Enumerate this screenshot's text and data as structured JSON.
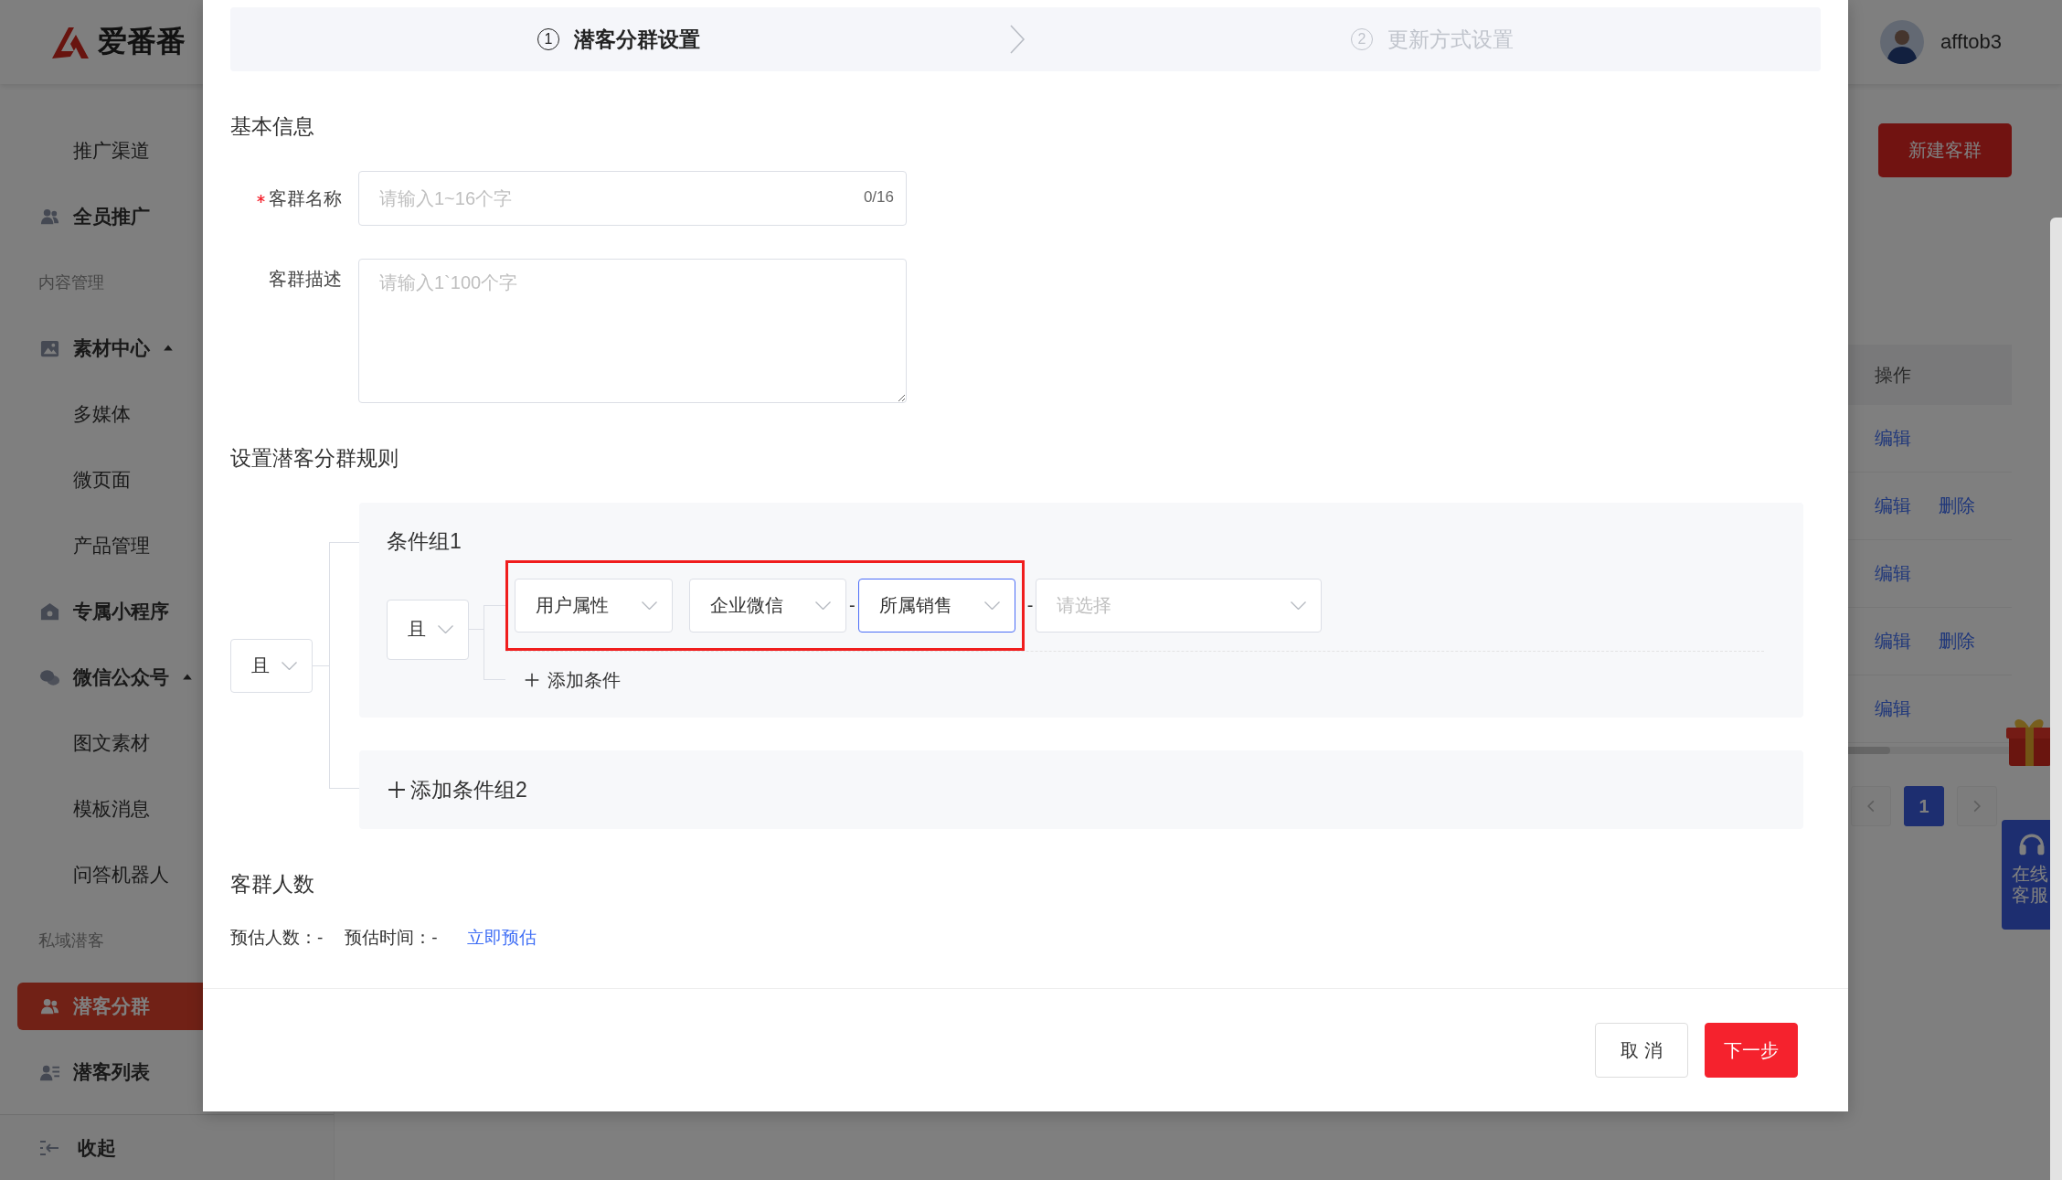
{
  "header": {
    "logo": "爱番番",
    "user": "afftob3"
  },
  "sidebar": {
    "items": [
      {
        "label": "推广渠道",
        "kind": "sub",
        "selected": false
      },
      {
        "label": "全员推广",
        "kind": "main",
        "selected": false
      },
      {
        "label": "内容管理",
        "kind": "section"
      },
      {
        "label": "素材中心",
        "kind": "main",
        "expanded": true,
        "selected": false
      },
      {
        "label": "多媒体",
        "kind": "sub",
        "selected": false
      },
      {
        "label": "微页面",
        "kind": "sub",
        "selected": false
      },
      {
        "label": "产品管理",
        "kind": "sub",
        "selected": false
      },
      {
        "label": "专属小程序",
        "kind": "main",
        "selected": false
      },
      {
        "label": "微信公众号",
        "kind": "main",
        "expanded": true,
        "selected": false
      },
      {
        "label": "图文素材",
        "kind": "sub",
        "selected": false
      },
      {
        "label": "模板消息",
        "kind": "sub",
        "selected": false
      },
      {
        "label": "问答机器人",
        "kind": "sub",
        "selected": false
      },
      {
        "label": "私域潜客",
        "kind": "section"
      },
      {
        "label": "潜客分群",
        "kind": "main",
        "selected": true
      },
      {
        "label": "潜客列表",
        "kind": "main",
        "selected": false
      }
    ],
    "collapse": "收起"
  },
  "main": {
    "new_button": "新建客群",
    "table": {
      "columns": [
        "操作"
      ],
      "rows": [
        {
          "actions": [
            "编辑"
          ]
        },
        {
          "actions": [
            "编辑",
            "删除"
          ]
        },
        {
          "actions": [
            "编辑"
          ]
        },
        {
          "actions": [
            "编辑",
            "删除"
          ]
        },
        {
          "actions": [
            "编辑"
          ]
        }
      ]
    },
    "pagination": {
      "pages": [
        {
          "label": "1",
          "selected": true
        }
      ]
    },
    "support": "在线客服"
  },
  "modal": {
    "steps": [
      {
        "number": "1",
        "label": "潜客分群设置",
        "selected": true
      },
      {
        "number": "2",
        "label": "更新方式设置",
        "selected": false
      }
    ],
    "basic_info": {
      "title": "基本信息",
      "fields": [
        {
          "kind": "input",
          "label": "客群名称",
          "required": true,
          "placeholder": "请输入1~16个字",
          "counter": "0/16"
        },
        {
          "kind": "textarea",
          "label": "客群描述",
          "required": false,
          "placeholder": "请输入1`100个字"
        }
      ]
    },
    "rules": {
      "title": "设置潜客分群规则",
      "logic": "且",
      "groups": [
        {
          "title": "条件组1",
          "logic": "且",
          "conditions": [
            {
              "selects": [
                {
                  "value": "用户属性",
                  "focused": false,
                  "highlighted": true
                },
                {
                  "value": "企业微信",
                  "focused": false,
                  "highlighted": true
                },
                {
                  "value": "所属销售",
                  "prefix": "-",
                  "focused": true,
                  "highlighted": true
                },
                {
                  "placeholder": "请选择",
                  "prefix": "-",
                  "focused": false,
                  "highlighted": false
                }
              ]
            }
          ],
          "add_condition": "添加条件"
        }
      ],
      "add_group": "添加条件组2"
    },
    "count": {
      "title": "客群人数",
      "estimates": [
        "预估人数：-",
        "预估时间：-"
      ],
      "link": "立即预估"
    },
    "buttons": [
      {
        "label": "取 消",
        "kind": "default"
      },
      {
        "label": "下一步",
        "kind": "primary"
      }
    ]
  }
}
